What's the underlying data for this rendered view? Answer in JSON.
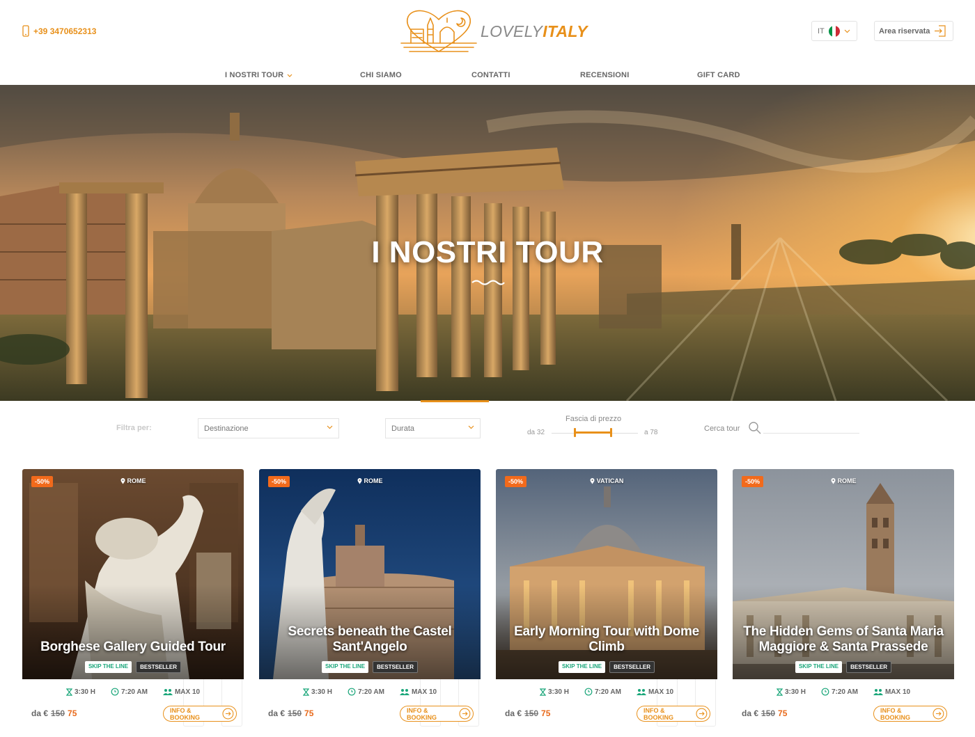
{
  "header": {
    "phone": "+39 3470652313",
    "logo": {
      "part1": "LOVELY",
      "part2": "ITALY"
    },
    "language": {
      "code": "IT"
    },
    "account_label": "Area riservata"
  },
  "nav": {
    "items": [
      {
        "label": "I NOSTRI TOUR"
      },
      {
        "label": "CHI SIAMO"
      },
      {
        "label": "CONTATTI"
      },
      {
        "label": "RECENSIONI"
      },
      {
        "label": "GIFT CARD"
      }
    ]
  },
  "hero": {
    "title": "I NOSTRI TOUR"
  },
  "filters": {
    "label": "Filtra per:",
    "destination": "Destinazione",
    "duration": "Durata",
    "price_title": "Fascia di prezzo",
    "price_min": "da 32",
    "price_max": "a 78",
    "search_label": "Cerca tour"
  },
  "tours": [
    {
      "discount": "-50%",
      "location": "ROME",
      "title": "Borghese Gallery Guided Tour",
      "tags": [
        "SKIP THE LINE",
        "BESTSELLER"
      ],
      "duration": "3:30 H",
      "time": "7:20 AM",
      "group": "MAX 10",
      "price_prefix": "da €",
      "old_price": "150",
      "new_price": "75",
      "cta": "INFO & BOOKING"
    },
    {
      "discount": "-50%",
      "location": "ROME",
      "title": "Secrets beneath the Castel Sant'Angelo",
      "tags": [
        "SKIP THE LINE",
        "BESTSELLER"
      ],
      "duration": "3:30 H",
      "time": "7:20 AM",
      "group": "MAX 10",
      "price_prefix": "da €",
      "old_price": "150",
      "new_price": "75",
      "cta": "INFO & BOOKING"
    },
    {
      "discount": "-50%",
      "location": "VATICAN",
      "title": "Early Morning Tour with Dome Climb",
      "tags": [
        "SKIP THE LINE",
        "BESTSELLER"
      ],
      "duration": "3:30 H",
      "time": "7:20 AM",
      "group": "MAX 10",
      "price_prefix": "da €",
      "old_price": "150",
      "new_price": "75",
      "cta": "INFO & BOOKING"
    },
    {
      "discount": "-50%",
      "location": "ROME",
      "title": "The Hidden Gems of Santa Maria Maggiore & Santa Prassede",
      "tags": [
        "SKIP THE LINE",
        "BESTSELLER"
      ],
      "duration": "3:30 H",
      "time": "7:20 AM",
      "group": "MAX 10",
      "price_prefix": "da €",
      "old_price": "150",
      "new_price": "75",
      "cta": "INFO & BOOKING"
    }
  ],
  "colors": {
    "accent": "#e8901a",
    "discount": "#f26a1b",
    "skip_tag": "#1aa67a"
  }
}
